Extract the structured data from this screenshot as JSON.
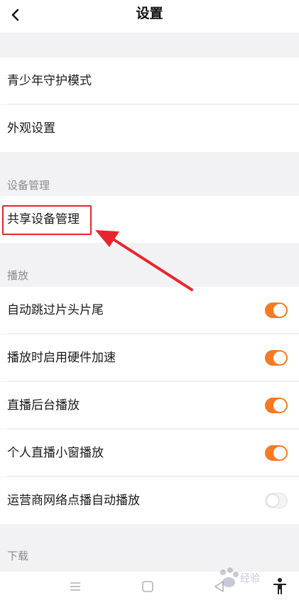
{
  "header": {
    "title": "设置"
  },
  "general": {
    "items": [
      {
        "label": "青少年守护模式"
      },
      {
        "label": "外观设置"
      }
    ]
  },
  "device_section": {
    "title": "设备管理",
    "items": [
      {
        "label": "共享设备管理"
      }
    ]
  },
  "playback_section": {
    "title": "播放",
    "items": [
      {
        "label": "自动跳过片头片尾",
        "enabled": true
      },
      {
        "label": "播放时启用硬件加速",
        "enabled": true
      },
      {
        "label": "直播后台播放",
        "enabled": true
      },
      {
        "label": "个人直播小窗播放",
        "enabled": true
      },
      {
        "label": "运营商网络点播自动播放",
        "enabled": false
      }
    ]
  },
  "download_section": {
    "title": "下载"
  },
  "watermark": {
    "text": "经验"
  },
  "colors": {
    "accent": "#f57a21",
    "annotation": "#e8252e",
    "background": "#f2f2f4"
  },
  "icons": {
    "back": "chevron-left-icon",
    "nav_menu": "menu-icon",
    "nav_home": "square-icon",
    "nav_back": "triangle-back-icon",
    "accessibility": "accessibility-icon"
  }
}
